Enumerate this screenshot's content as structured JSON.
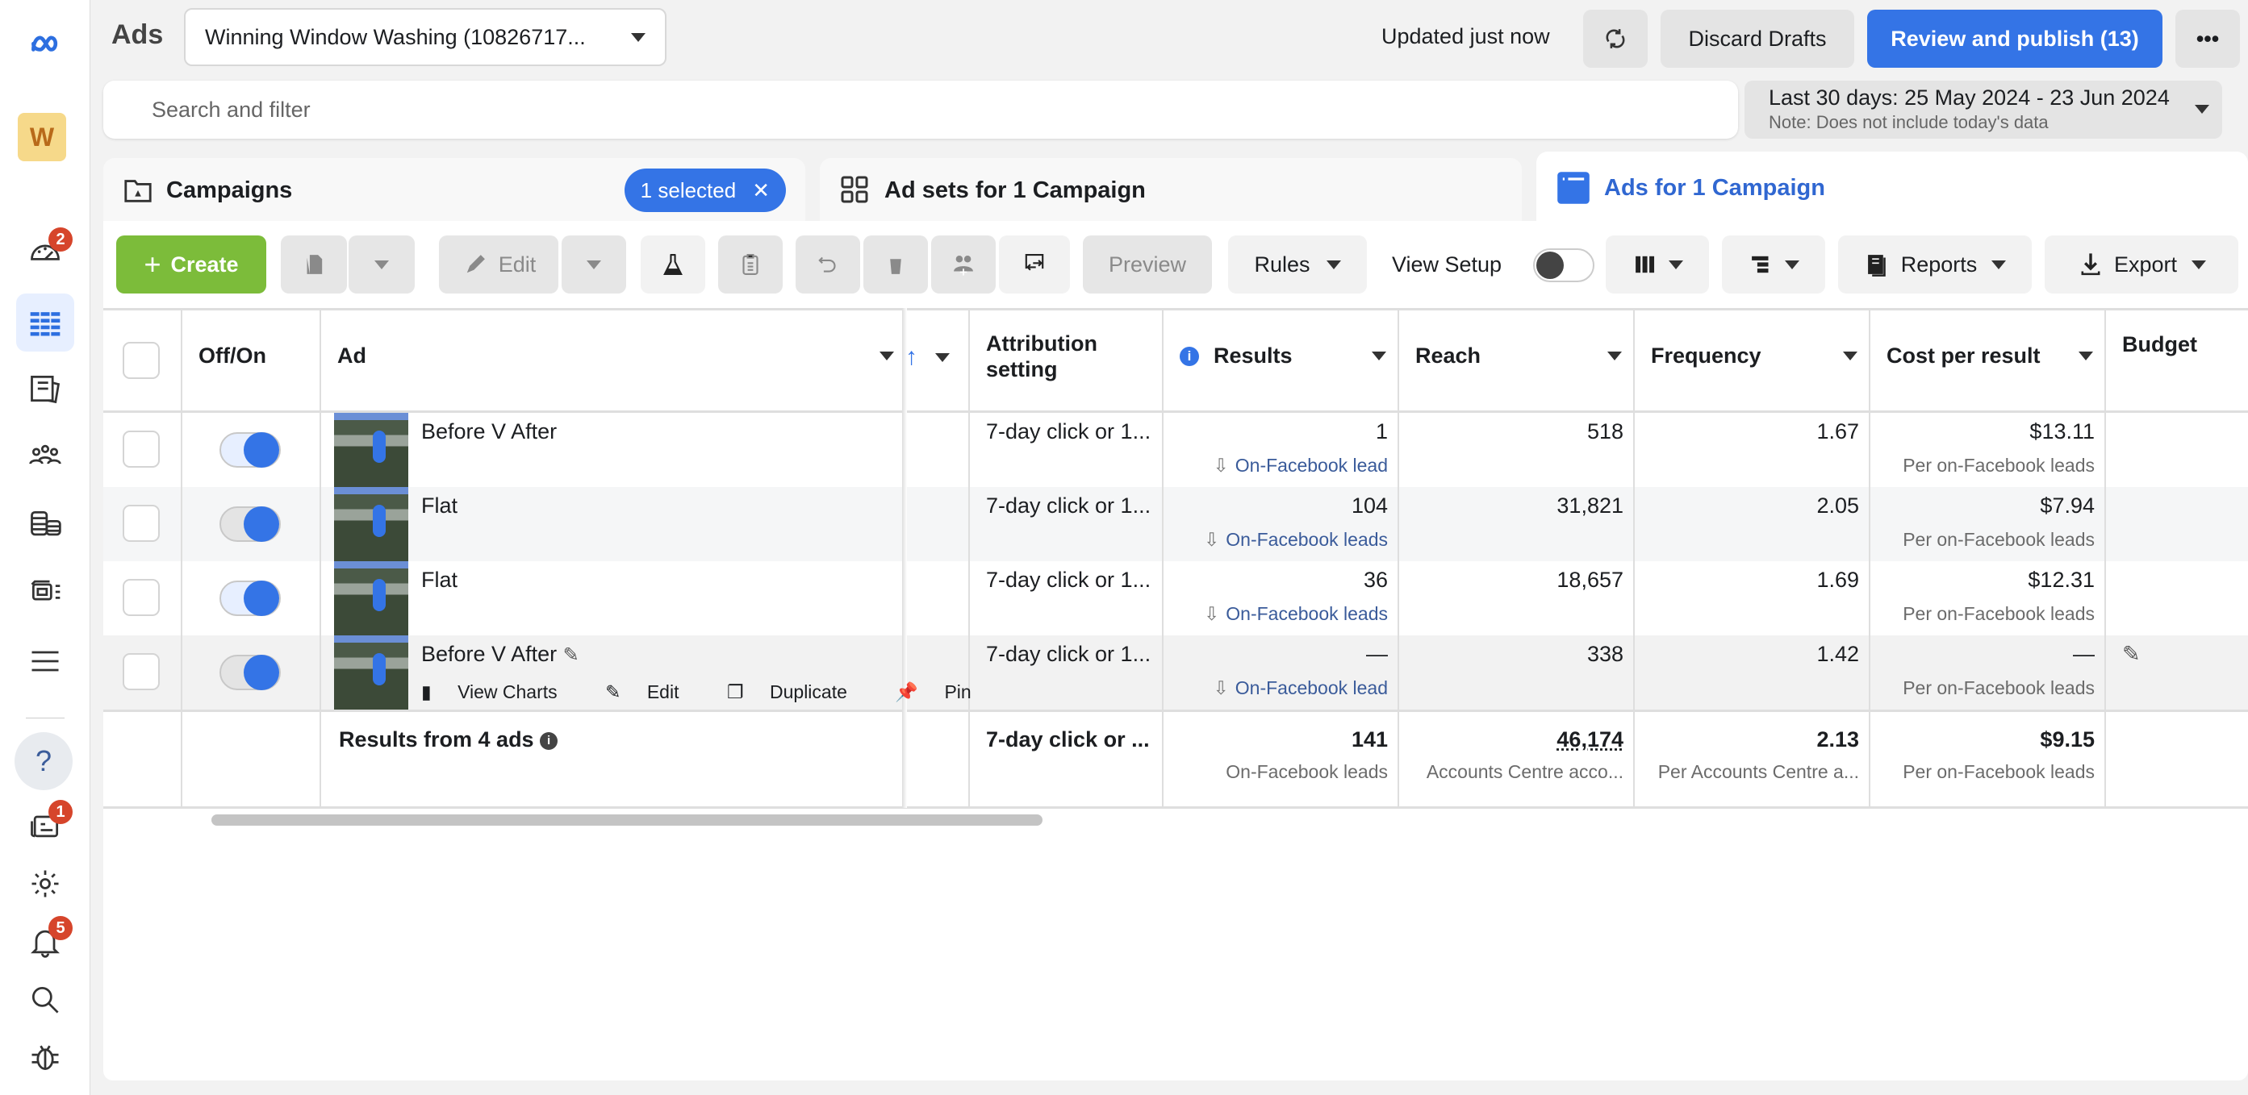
{
  "topbar": {
    "app_title": "Ads",
    "account_name": "Winning Window Washing (10826717...",
    "updated_status": "Updated just now",
    "discard_drafts_label": "Discard Drafts",
    "review_publish_label": "Review and publish (13)",
    "more_label": "•••"
  },
  "search": {
    "placeholder": "Search and filter"
  },
  "date_range": {
    "label": "Last 30 days: 25 May 2024 - 23 Jun 2024",
    "note": "Note: Does not include today's data"
  },
  "rail": {
    "logo": "meta-logo",
    "account_initial": "W",
    "badges": {
      "overview": "2",
      "messages": "1",
      "notifications": "5"
    },
    "help_label": "?"
  },
  "tabs": {
    "campaigns": {
      "label": "Campaigns",
      "selected_label": "1 selected",
      "clear": "✕"
    },
    "adsets": {
      "label": "Ad sets for 1 Campaign"
    },
    "ads": {
      "label": "Ads for 1 Campaign"
    }
  },
  "toolbar": {
    "create_label": "Create",
    "edit_label": "Edit",
    "preview_label": "Preview",
    "rules_label": "Rules",
    "view_setup_label": "View Setup",
    "reports_label": "Reports",
    "export_label": "Export"
  },
  "table": {
    "headers": {
      "off_on": "Off/On",
      "ad": "Ad",
      "attribution": [
        "Attribution",
        "setting"
      ],
      "results": "Results",
      "reach": "Reach",
      "frequency": "Frequency",
      "cost_per_result": "Cost per result",
      "budget": "Budget"
    },
    "rows": [
      {
        "name": "Before V After",
        "enabled": true,
        "attribution": "7-day click or 1...",
        "results": "1",
        "results_type": "On-Facebook lead",
        "reach": "518",
        "frequency": "1.67",
        "cost": "$13.11",
        "cost_sub": "Per on-Facebook leads"
      },
      {
        "name": "Flat",
        "enabled": true,
        "attribution": "7-day click or 1...",
        "results": "104",
        "results_type": "On-Facebook leads",
        "reach": "31,821",
        "frequency": "2.05",
        "cost": "$7.94",
        "cost_sub": "Per on-Facebook leads"
      },
      {
        "name": "Flat",
        "enabled": true,
        "attribution": "7-day click or 1...",
        "results": "36",
        "results_type": "On-Facebook leads",
        "reach": "18,657",
        "frequency": "1.69",
        "cost": "$12.31",
        "cost_sub": "Per on-Facebook leads"
      },
      {
        "name": "Before V After",
        "enabled": true,
        "attribution": "7-day click or 1...",
        "results": "—",
        "results_type": "On-Facebook lead",
        "reach": "338",
        "frequency": "1.42",
        "cost": "—",
        "cost_sub": "Per on-Facebook leads"
      }
    ],
    "row_actions": {
      "view_charts": "View Charts",
      "edit": "Edit",
      "duplicate": "Duplicate",
      "pin": "Pin"
    },
    "summary": {
      "label": "Results from 4 ads",
      "attribution": "7-day click or ...",
      "results": "141",
      "results_sub": "On-Facebook leads",
      "reach": "46,174",
      "reach_sub": "Accounts Centre acco...",
      "frequency": "2.13",
      "frequency_sub": "Per Accounts Centre a...",
      "cost": "$9.15",
      "cost_sub": "Per on-Facebook leads"
    }
  },
  "colors": {
    "accent": "#3474e6",
    "create_green": "#7cbc3a",
    "badge_red": "#d6452b"
  }
}
